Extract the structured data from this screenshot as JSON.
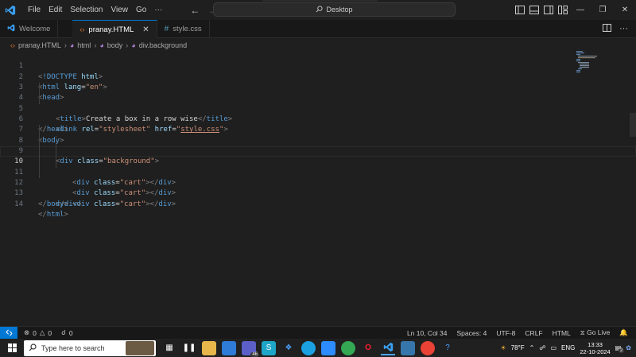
{
  "titlebar": {
    "menu": [
      "File",
      "Edit",
      "Selection",
      "View",
      "Go",
      "···"
    ],
    "search_text": "Desktop",
    "accent_color": "#0078d4"
  },
  "tabs": [
    {
      "label": "Welcome",
      "icon": "vscode-icon",
      "active": false
    },
    {
      "label": "pranay.HTML",
      "icon": "html-icon",
      "active": true,
      "close": "✕"
    },
    {
      "label": "style.css",
      "icon": "css-hash-icon",
      "active": false
    }
  ],
  "breadcrumb": [
    "pranay.HTML",
    "html",
    "body",
    "div.background"
  ],
  "editor": {
    "current_line": 10,
    "lines": [
      {
        "n": "1"
      },
      {
        "n": "2"
      },
      {
        "n": "3"
      },
      {
        "n": "4"
      },
      {
        "n": "5"
      },
      {
        "n": "6"
      },
      {
        "n": "7"
      },
      {
        "n": "8"
      },
      {
        "n": "9"
      },
      {
        "n": "10"
      },
      {
        "n": "11"
      },
      {
        "n": "12"
      },
      {
        "n": "13"
      },
      {
        "n": "14"
      }
    ],
    "tokens": {
      "doctype": "!DOCTYPE",
      "html": "html",
      "lang": "lang",
      "en": "\"en\"",
      "head": "head",
      "title": "title",
      "title_text": "Create a box in a row wise",
      "link": "link",
      "rel": "rel",
      "stylesheet": "\"stylesheet\"",
      "href": "href",
      "css_file": "style.css",
      "body": "body",
      "div": "div",
      "class": "class",
      "background": "\"background\"",
      "cart": "\"cart\""
    }
  },
  "statusbar": {
    "errors": "0",
    "warnings": "0",
    "ports": "0",
    "position": "Ln 10, Col 34",
    "spaces": "Spaces: 4",
    "encoding": "UTF-8",
    "eol": "CRLF",
    "language": "HTML",
    "golive": "Go Live"
  },
  "taskbar": {
    "search_placeholder": "Type here to search",
    "weather": "78°F",
    "lang": "ENG",
    "time": "13:33",
    "date": "22-10-2024",
    "notif_badge": "46",
    "notif_count": "2"
  }
}
